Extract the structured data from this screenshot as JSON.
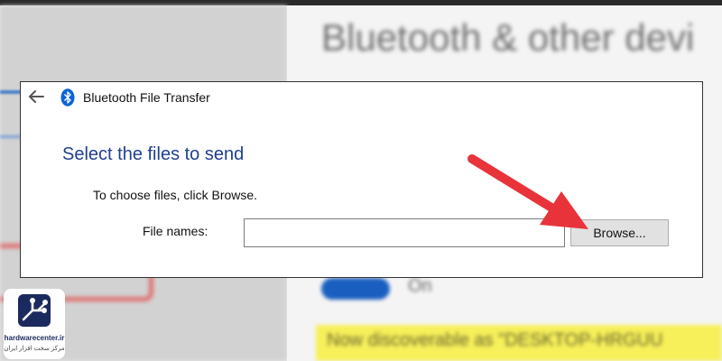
{
  "background": {
    "title": "Bluetooth & other devi",
    "toggle_label": "On",
    "highlight_text": "Now discoverable as \"DESKTOP-HRGUU"
  },
  "dialog": {
    "title": "Bluetooth File Transfer",
    "back_icon": "arrow-left",
    "app_icon": "bluetooth",
    "heading": "Select the files to send",
    "instruction": "To choose files, click Browse.",
    "file_names_label": "File names:",
    "file_names_value": "",
    "browse_label": "Browse..."
  },
  "annotation": {
    "arrow_color": "#e8333a"
  },
  "watermark": {
    "site": "hardwarecenter.ir",
    "subtitle": "مرکز سخت افزار ایران"
  },
  "colors": {
    "heading": "#1f3f8f",
    "bluetooth": "#0a64d8",
    "highlight": "#f7f05a"
  }
}
